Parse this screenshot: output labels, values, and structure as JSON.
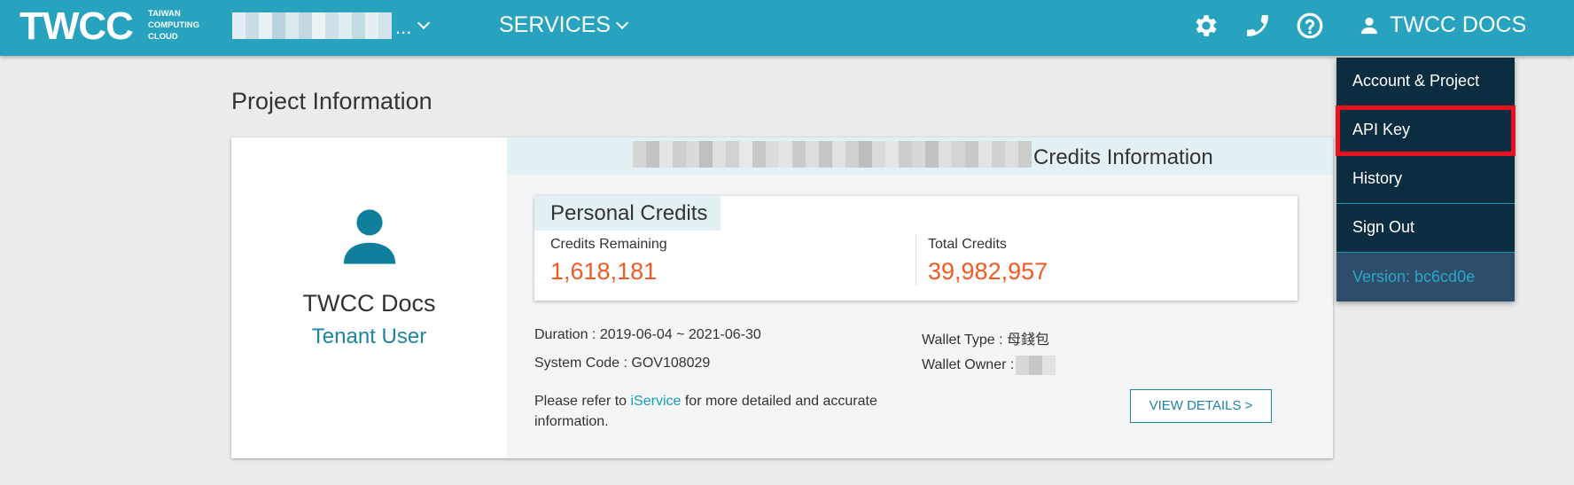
{
  "header": {
    "logo_word": "TWCC",
    "logo_sub": [
      "TAIWAN",
      "COMPUTING",
      "CLOUD"
    ],
    "project_ellipsis": "...",
    "services_label": "SERVICES",
    "icons": [
      "gear-icon",
      "phone-icon",
      "help-icon",
      "user-icon"
    ],
    "user_label": "TWCC DOCS"
  },
  "page": {
    "title": "Project Information"
  },
  "profile": {
    "name": "TWCC Docs",
    "role": "Tenant User"
  },
  "credits": {
    "header_title": "Credits Information",
    "personal_tab": "Personal Credits",
    "remaining_label": "Credits Remaining",
    "remaining_value": "1,618,181",
    "total_label": "Total Credits",
    "total_value": "39,982,957"
  },
  "details": {
    "duration_label": "Duration : ",
    "duration_value": "2019-06-04 ~ 2021-06-30",
    "system_code_label": "System Code : ",
    "system_code_value": "GOV108029",
    "wallet_type_label": "Wallet Type : ",
    "wallet_type_value": "母錢包",
    "wallet_owner_label": "Wallet Owner : ",
    "refer_prefix": "Please refer to ",
    "refer_link": "iService",
    "refer_suffix_1": " for more detailed and accurate",
    "refer_suffix_2": "information.",
    "view_details_label": "VIEW DETAILS >"
  },
  "dropdown": {
    "items": [
      {
        "label": "Account & Project"
      },
      {
        "label": "API Key"
      },
      {
        "label": "History"
      },
      {
        "label": "Sign Out"
      }
    ],
    "version": "Version: bc6cd0e"
  },
  "colors": {
    "topbar": "#27a3c0",
    "dropdown_bg": "#0c2d40",
    "highlight": "#e8121f",
    "credit_number": "#f15a24",
    "link": "#1a9bbf"
  }
}
